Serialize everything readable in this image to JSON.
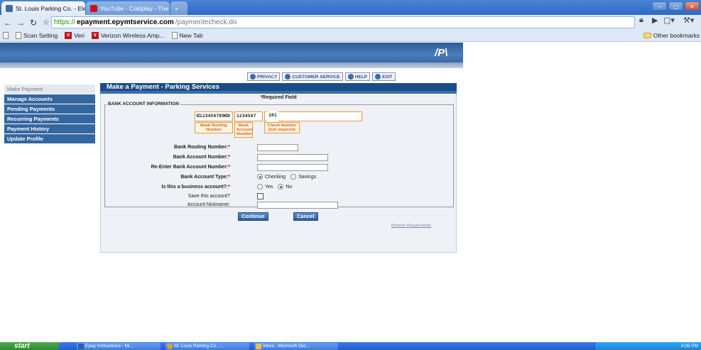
{
  "browser": {
    "tabs": [
      {
        "title": "St. Louis Parking Co. - Elec...",
        "active": true
      },
      {
        "title": "YouTube - Coldplay - The S...",
        "active": false
      },
      {
        "title": "",
        "active": false
      }
    ],
    "url": {
      "scheme": "https://",
      "domain": "epayment.epymtservice.com",
      "path": "/paymentecheck.do"
    },
    "bookmarks": [
      {
        "label": "",
        "icon": "page-icon"
      },
      {
        "label": "Scan Setting",
        "icon": "page-icon"
      },
      {
        "label": "Veri",
        "icon": "verizon-icon"
      },
      {
        "label": "Verizon Wireless Amp...",
        "icon": "verizon-icon"
      },
      {
        "label": "New Tab",
        "icon": "page-icon"
      }
    ],
    "other_bookmarks": "Other bookmarks"
  },
  "site": {
    "logo_text": "/P\\",
    "sidebar": [
      {
        "label": "Make Payment",
        "current": true
      },
      {
        "label": "Manage Accounts",
        "current": false
      },
      {
        "label": "Pending Payments",
        "current": false
      },
      {
        "label": "Recurring Payments",
        "current": false
      },
      {
        "label": "Payment History",
        "current": false
      },
      {
        "label": "Update Profile",
        "current": false
      }
    ],
    "topnav": {
      "privacy": "PRIVACY",
      "customer_service": "CUSTOMER SERVICE",
      "help": "HELP",
      "exit": "EXIT"
    }
  },
  "form": {
    "title": "Make a Payment - Parking Services",
    "required_note": "Required Field",
    "section_legend": "BANK ACCOUNT INFORMATION",
    "check_sample": {
      "routing_digits": "⑆123456789⑆0",
      "account_digits": "1234567",
      "check_digits": "101",
      "routing_label": "Bank Routing Number",
      "account_label": "Bank Account Number",
      "check_label": "Check Number (not required)"
    },
    "fields": {
      "routing": {
        "label": "Bank Routing Number:",
        "value": ""
      },
      "account": {
        "label": "Bank Account Number:",
        "value": ""
      },
      "reenter": {
        "label": "Re-Enter Bank Account Number:",
        "value": ""
      },
      "account_type": {
        "label": "Bank Account Type:",
        "options": [
          "Checking",
          "Savings"
        ],
        "selected": "Checking"
      },
      "business": {
        "label": "Is this a business account?:",
        "options": [
          "Yes",
          "No"
        ],
        "selected": "No"
      },
      "save": {
        "label": "Save this account?",
        "checked": false
      },
      "nickname": {
        "label": "Account Nickname:",
        "value": ""
      }
    },
    "buttons": {
      "continue": "Continue",
      "cancel": "Cancel"
    },
    "browser_requirements": "Browser Requirements"
  },
  "taskbar": {
    "start": "start",
    "tasks": [
      "Epay Instructions - Mi...",
      "St. Louis Parking Co. ...",
      "Inbox - Microsoft Out..."
    ],
    "clock": "4:08 PM"
  },
  "colors": {
    "accent": "#1b4c86",
    "sidebar": "#35679f",
    "required": "#dd0000",
    "check_orange": "#e69a34"
  }
}
